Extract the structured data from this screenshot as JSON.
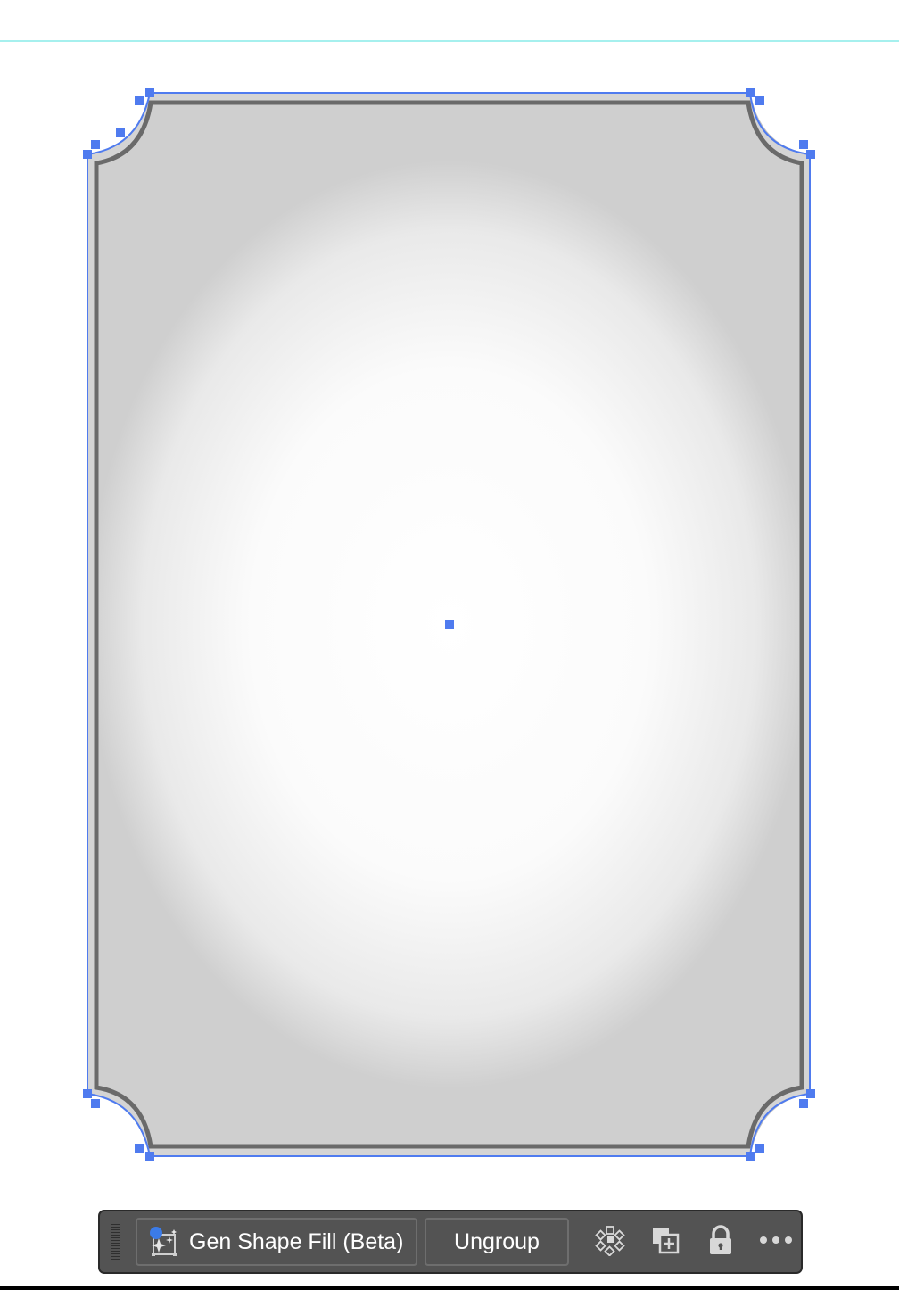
{
  "taskbar": {
    "gen_shape_fill_label": "Gen Shape Fill (Beta)",
    "ungroup_label": "Ungroup",
    "icons": [
      "gen-shape-fill-icon",
      "isolate-group-icon",
      "duplicate-icon",
      "lock-icon",
      "more-options-icon"
    ]
  },
  "colors": {
    "selection": "#4f7bef",
    "frame_stroke": "#6a6a6a",
    "taskbar_bg": "#535353",
    "guide": "#a6f0ee"
  }
}
